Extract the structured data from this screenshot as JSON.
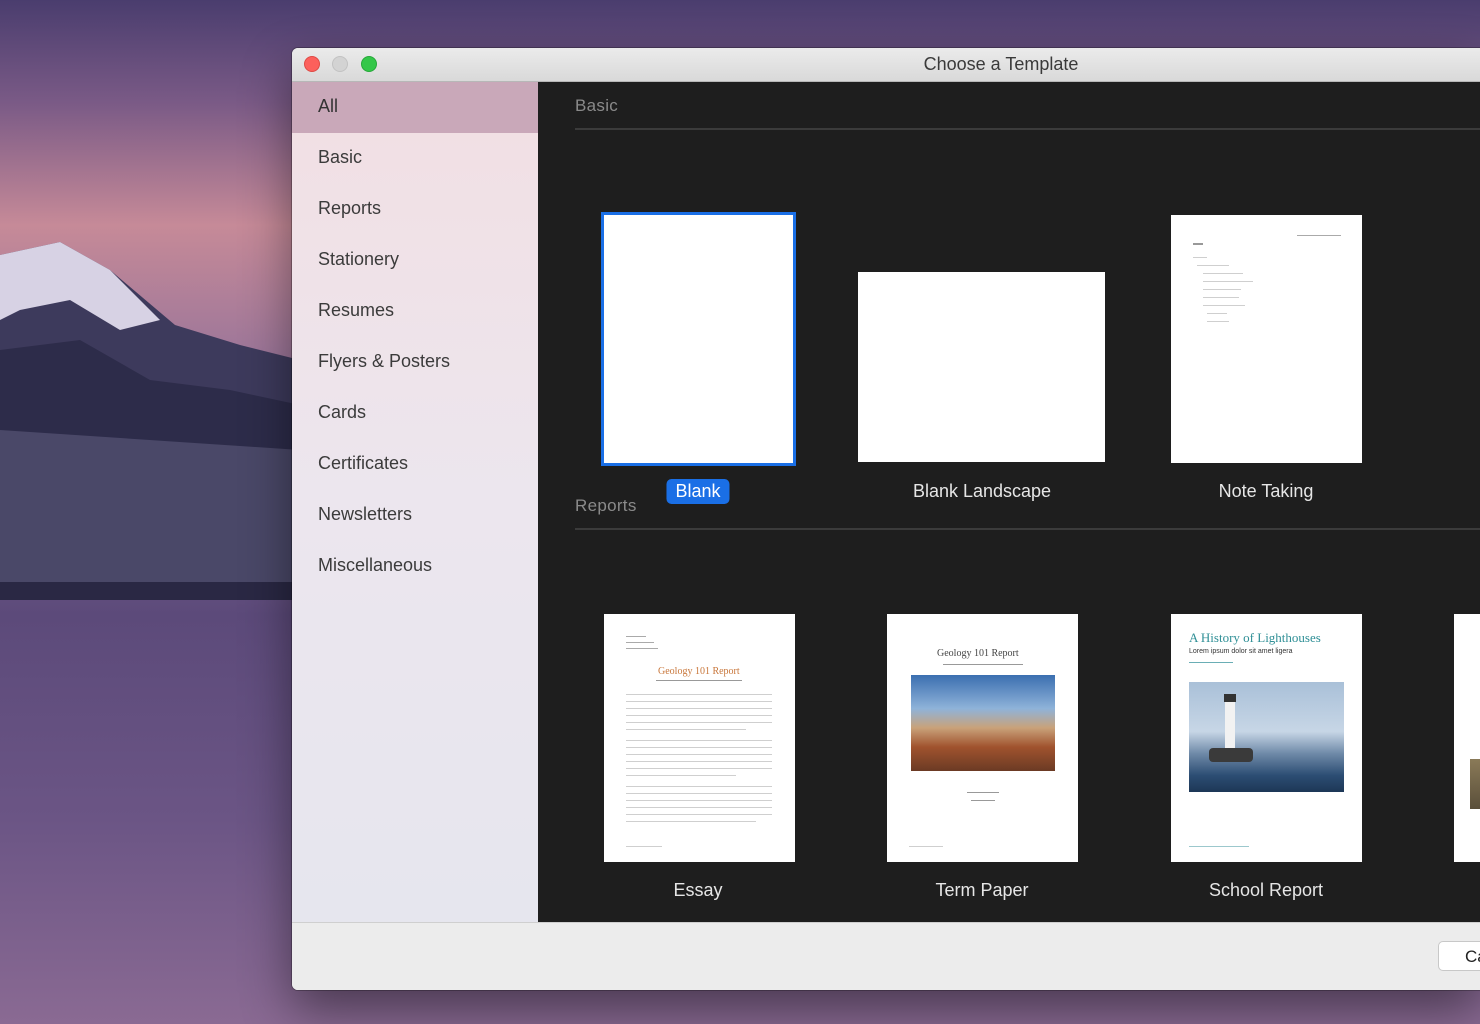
{
  "window": {
    "title": "Choose a Template"
  },
  "sidebar": {
    "items": [
      {
        "label": "All",
        "selected": true
      },
      {
        "label": "Basic"
      },
      {
        "label": "Reports"
      },
      {
        "label": "Stationery"
      },
      {
        "label": "Resumes"
      },
      {
        "label": "Flyers & Posters"
      },
      {
        "label": "Cards"
      },
      {
        "label": "Certificates"
      },
      {
        "label": "Newsletters"
      },
      {
        "label": "Miscellaneous"
      }
    ]
  },
  "sections": {
    "basic": {
      "heading": "Basic",
      "templates": [
        {
          "label": "Blank",
          "selected": true
        },
        {
          "label": "Blank Landscape"
        },
        {
          "label": "Note Taking"
        }
      ]
    },
    "reports": {
      "heading": "Reports",
      "templates": [
        {
          "label": "Essay",
          "doc_title": "Geology 101 Report"
        },
        {
          "label": "Term Paper",
          "doc_title": "Geology 101 Report"
        },
        {
          "label": "School Report",
          "doc_title": "A History of Lighthouses",
          "doc_subtitle": "Lorem ipsum dolor sit amet ligera"
        }
      ]
    }
  },
  "footer": {
    "cancel_label": "Cancel"
  },
  "colors": {
    "accent": "#1a6fe6",
    "close": "#fc605c",
    "zoom": "#34c749",
    "content_bg": "#1e1e1e"
  }
}
